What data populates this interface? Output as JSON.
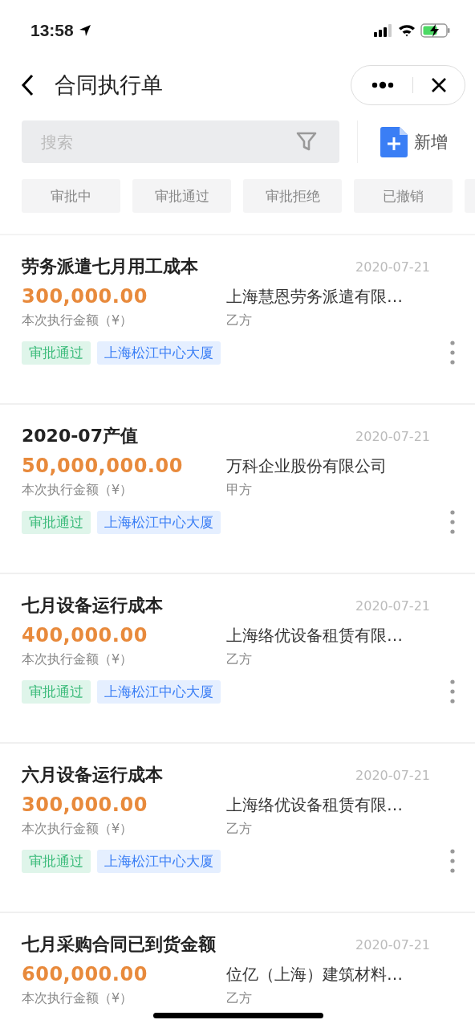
{
  "status_bar": {
    "time": "13:58"
  },
  "header": {
    "title": "合同执行单"
  },
  "search": {
    "placeholder": "搜索"
  },
  "add_button": {
    "label": "新增"
  },
  "filters": [
    {
      "label": "审批中",
      "selected": false
    },
    {
      "label": "审批通过",
      "selected": false
    },
    {
      "label": "审批拒绝",
      "selected": false
    },
    {
      "label": "已撤销",
      "selected": false
    }
  ],
  "records": [
    {
      "title": "劳务派遣七月用工成本",
      "date": "2020-07-21",
      "amount": "300,000.00",
      "amount_label": "本次执行金额（¥）",
      "party": "上海慧恩劳务派遣有限…",
      "party_role": "乙方",
      "tags": [
        {
          "kind": "status",
          "label": "审批通过"
        },
        {
          "kind": "location",
          "label": "上海松江中心大厦"
        }
      ]
    },
    {
      "title": "2020-07产值",
      "date": "2020-07-21",
      "amount": "50,000,000.00",
      "amount_label": "本次执行金额（¥）",
      "party": "万科企业股份有限公司",
      "party_role": "甲方",
      "tags": [
        {
          "kind": "status",
          "label": "审批通过"
        },
        {
          "kind": "location",
          "label": "上海松江中心大厦"
        }
      ]
    },
    {
      "title": "七月设备运行成本",
      "date": "2020-07-21",
      "amount": "400,000.00",
      "amount_label": "本次执行金额（¥）",
      "party": "上海络优设备租赁有限…",
      "party_role": "乙方",
      "tags": [
        {
          "kind": "status",
          "label": "审批通过"
        },
        {
          "kind": "location",
          "label": "上海松江中心大厦"
        }
      ]
    },
    {
      "title": "六月设备运行成本",
      "date": "2020-07-21",
      "amount": "300,000.00",
      "amount_label": "本次执行金额（¥）",
      "party": "上海络优设备租赁有限…",
      "party_role": "乙方",
      "tags": [
        {
          "kind": "status",
          "label": "审批通过"
        },
        {
          "kind": "location",
          "label": "上海松江中心大厦"
        }
      ]
    },
    {
      "title": "七月采购合同已到货金额",
      "date": "2020-07-21",
      "amount": "600,000.00",
      "amount_label": "本次执行金额（¥）",
      "party": "位亿（上海）建筑材料…",
      "party_role": "乙方"
    }
  ]
}
